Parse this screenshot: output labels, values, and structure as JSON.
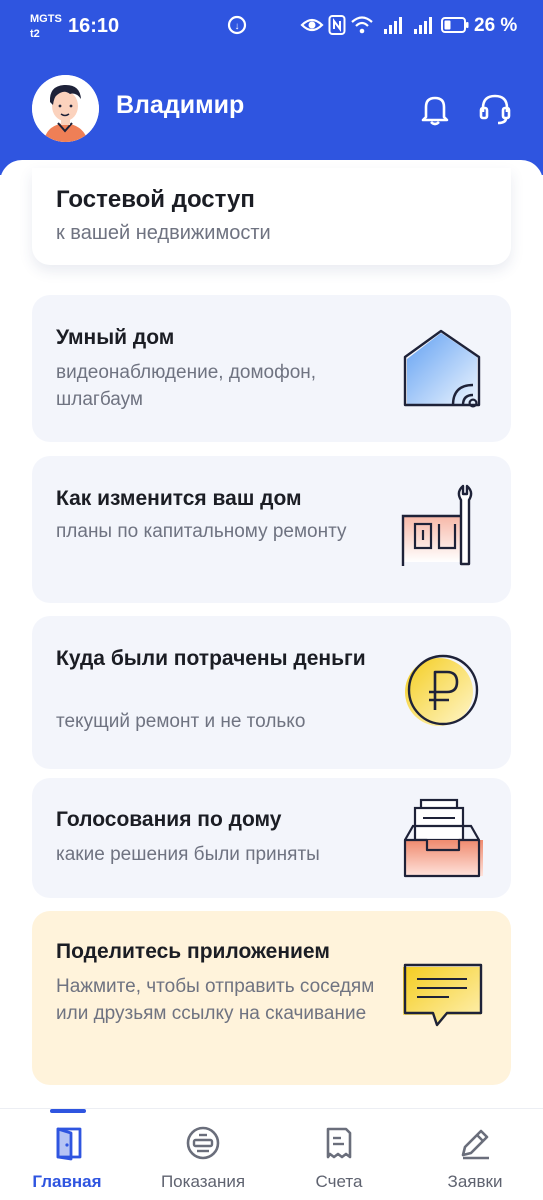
{
  "status_bar": {
    "carrier_top": "MGTS",
    "carrier_bottom": "t2",
    "time": "16:10",
    "battery": "26 %"
  },
  "user": {
    "name": "Владимир"
  },
  "guest_access": {
    "title": "Гостевой доступ",
    "subtitle": "к вашей недвижимости"
  },
  "cards": [
    {
      "title": "Умный дом",
      "subtitle": "видеонаблюдение, домофон, шлагбаум",
      "icon": "smart-home-icon"
    },
    {
      "title": "Как изменится ваш дом",
      "subtitle": "планы по капитальному ремонту",
      "icon": "renovation-plan-icon"
    },
    {
      "title": "Куда были потрачены деньги",
      "subtitle": "текущий ремонт и не только",
      "icon": "ruble-coin-icon"
    },
    {
      "title": "Голосования по дому",
      "subtitle": "какие решения были приняты",
      "icon": "ballot-box-icon"
    },
    {
      "title": "Поделитесь приложением",
      "subtitle": "Нажмите, чтобы отправить соседям или друзьям ссылку на скачивание",
      "icon": "share-message-icon"
    }
  ],
  "nav": [
    {
      "label": "Главная",
      "icon": "home-door-icon",
      "active": true
    },
    {
      "label": "Показания",
      "icon": "meter-icon",
      "active": false
    },
    {
      "label": "Счета",
      "icon": "receipt-icon",
      "active": false
    },
    {
      "label": "Заявки",
      "icon": "pencil-icon",
      "active": false
    }
  ],
  "colors": {
    "brand_blue": "#2f55e0",
    "card_background": "#f3f5fb",
    "share_card_background": "#fff3db",
    "title_text": "#1b1d24",
    "subtitle_text": "#6f7381"
  }
}
